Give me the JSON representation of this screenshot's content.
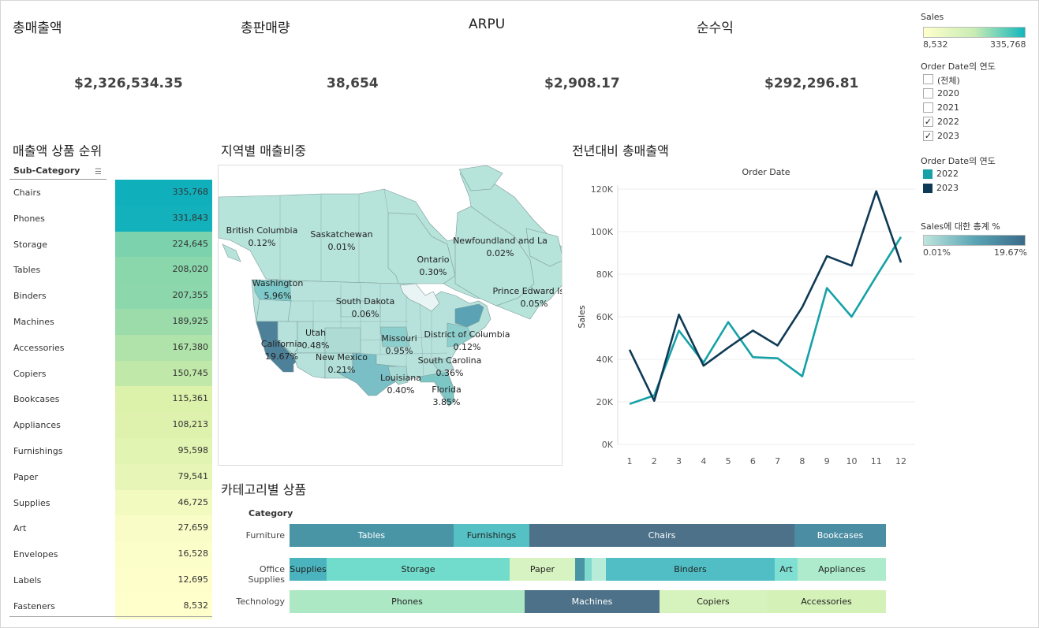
{
  "kpis": [
    {
      "title": "총매출액",
      "value": "$2,326,534.35"
    },
    {
      "title": "총판매량",
      "value": "38,654"
    },
    {
      "title": "ARPU",
      "value": "$2,908.17"
    },
    {
      "title": "순수익",
      "value": "$292,296.81"
    }
  ],
  "ranking": {
    "title": "매출액 상품 순위",
    "header": "Sub-Category",
    "rows": [
      {
        "name": "Chairs",
        "value": "335,768",
        "v": 335768
      },
      {
        "name": "Phones",
        "value": "331,843",
        "v": 331843
      },
      {
        "name": "Storage",
        "value": "224,645",
        "v": 224645
      },
      {
        "name": "Tables",
        "value": "208,020",
        "v": 208020
      },
      {
        "name": "Binders",
        "value": "207,355",
        "v": 207355
      },
      {
        "name": "Machines",
        "value": "189,925",
        "v": 189925
      },
      {
        "name": "Accessories",
        "value": "167,380",
        "v": 167380
      },
      {
        "name": "Copiers",
        "value": "150,745",
        "v": 150745
      },
      {
        "name": "Bookcases",
        "value": "115,361",
        "v": 115361
      },
      {
        "name": "Appliances",
        "value": "108,213",
        "v": 108213
      },
      {
        "name": "Furnishings",
        "value": "95,598",
        "v": 95598
      },
      {
        "name": "Paper",
        "value": "79,541",
        "v": 79541
      },
      {
        "name": "Supplies",
        "value": "46,725",
        "v": 46725
      },
      {
        "name": "Art",
        "value": "27,659",
        "v": 27659
      },
      {
        "name": "Envelopes",
        "value": "16,528",
        "v": 16528
      },
      {
        "name": "Labels",
        "value": "12,695",
        "v": 12695
      },
      {
        "name": "Fasteners",
        "value": "8,532",
        "v": 8532
      }
    ]
  },
  "map": {
    "title": "지역별 매출비중",
    "labels": [
      {
        "name": "British Columbia",
        "pct": "0.12%"
      },
      {
        "name": "Saskatchewan",
        "pct": "0.01%"
      },
      {
        "name": "Newfoundland and La",
        "pct": "0.02%"
      },
      {
        "name": "Ontario",
        "pct": "0.30%"
      },
      {
        "name": "Washington",
        "pct": "5.96%"
      },
      {
        "name": "Prince Edward Islar",
        "pct": "0.05%"
      },
      {
        "name": "South Dakota",
        "pct": "0.06%"
      },
      {
        "name": "Utah",
        "pct": "0.48%"
      },
      {
        "name": "California",
        "pct": "19.67%"
      },
      {
        "name": "Missouri",
        "pct": "0.95%"
      },
      {
        "name": "District of Columbia",
        "pct": "0.12%"
      },
      {
        "name": "New Mexico",
        "pct": "0.21%"
      },
      {
        "name": "South Carolina",
        "pct": "0.36%"
      },
      {
        "name": "Louisiana",
        "pct": "0.40%"
      },
      {
        "name": "Florida",
        "pct": "3.85%"
      }
    ]
  },
  "legends": {
    "sales_title": "Sales",
    "sales_min": "8,532",
    "sales_max": "335,768",
    "year_filter_title": "Order Date의 연도",
    "year_filter": [
      {
        "label": "(전체)",
        "checked": false
      },
      {
        "label": "2020",
        "checked": false
      },
      {
        "label": "2021",
        "checked": false
      },
      {
        "label": "2022",
        "checked": true
      },
      {
        "label": "2023",
        "checked": true
      }
    ],
    "year_color_title": "Order Date의 연도",
    "year_colors": [
      {
        "label": "2022",
        "color": "#16a1a6"
      },
      {
        "label": "2023",
        "color": "#0f3a55"
      }
    ],
    "pct_title": "Sales에 대한 총계 %",
    "pct_min": "0.01%",
    "pct_max": "19.67%"
  },
  "chart_data": {
    "type": "line",
    "title": "전년대비 총매출액",
    "xlabel": "Order Date",
    "ylabel": "Sales",
    "x": [
      1,
      2,
      3,
      4,
      5,
      6,
      7,
      8,
      9,
      10,
      11,
      12
    ],
    "ylim": [
      0,
      120000
    ],
    "yticks": [
      "0K",
      "20K",
      "40K",
      "60K",
      "80K",
      "100K",
      "120K"
    ],
    "series": [
      {
        "name": "2022",
        "color": "#16a1a6",
        "values": [
          19000,
          23000,
          53500,
          38500,
          57500,
          41000,
          40500,
          32000,
          73500,
          60000,
          79000,
          97500
        ]
      },
      {
        "name": "2023",
        "color": "#0f3a55",
        "values": [
          44500,
          20500,
          61000,
          37000,
          45500,
          53500,
          46500,
          64500,
          88500,
          84000,
          119000,
          85500
        ]
      }
    ]
  },
  "category": {
    "title": "카테고리별 상품",
    "header": "Category",
    "rows": [
      {
        "name": "Furniture",
        "segments": [
          {
            "label": "Tables",
            "color": "#4995a6",
            "w": 208,
            "text": "#fff"
          },
          {
            "label": "Furnishings",
            "color": "#55c1c4",
            "w": 96,
            "text": "#222"
          },
          {
            "label": "Chairs",
            "color": "#4c7189",
            "w": 336,
            "text": "#fff"
          },
          {
            "label": "Bookcases",
            "color": "#4b8da2",
            "w": 116,
            "text": "#fff"
          }
        ]
      },
      {
        "name": "Office Supplies",
        "segments": [
          {
            "label": "Supplies",
            "color": "#4bb3bd",
            "w": 47,
            "text": "#222"
          },
          {
            "label": "Storage",
            "color": "#72dccc",
            "w": 232,
            "text": "#222"
          },
          {
            "label": "Paper",
            "color": "#d7f3c1",
            "w": 83,
            "text": "#222"
          },
          {
            "label": "",
            "color": "#4995a6",
            "w": 12,
            "text": "#222"
          },
          {
            "label": "",
            "color": "#80d9cd",
            "w": 9,
            "text": "#222"
          },
          {
            "label": "",
            "color": "#b7ecd8",
            "w": 18,
            "text": "#222"
          },
          {
            "label": "Binders",
            "color": "#50bec4",
            "w": 214,
            "text": "#222"
          },
          {
            "label": "Art",
            "color": "#80dfd3",
            "w": 29,
            "text": "#222"
          },
          {
            "label": "Appliances",
            "color": "#adebcc",
            "w": 112,
            "text": "#222"
          }
        ]
      },
      {
        "name": "Technology",
        "segments": [
          {
            "label": "Phones",
            "color": "#ade8c5",
            "w": 298,
            "text": "#222"
          },
          {
            "label": "Machines",
            "color": "#4c7189",
            "w": 171,
            "text": "#fff"
          },
          {
            "label": "Copiers",
            "color": "#d7f3bd",
            "w": 136,
            "text": "#222"
          },
          {
            "label": "Accessories",
            "color": "#d4f2b8",
            "w": 151,
            "text": "#222"
          }
        ]
      }
    ]
  }
}
